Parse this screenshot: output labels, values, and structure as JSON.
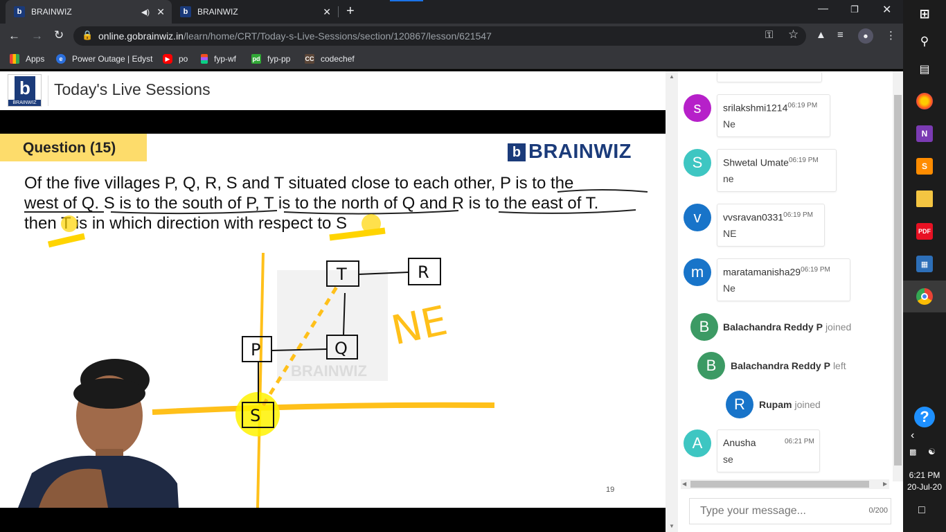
{
  "browser": {
    "tabs": [
      {
        "title": "BRAINWIZ",
        "active": true
      },
      {
        "title": "BRAINWIZ",
        "active": false
      }
    ],
    "url_host": "online.gobrainwiz.in",
    "url_path": "/learn/home/CRT/Today-s-Live-Sessions/section/120867/lesson/621547",
    "bookmarks": [
      "Apps",
      "Power Outage | Edyst",
      "po",
      "fyp-wf",
      "fyp-pp",
      "codechef"
    ]
  },
  "page": {
    "title": "Today's Live Sessions",
    "logo_text": "BRAINWIZ"
  },
  "slide": {
    "question_label": "Question (15)",
    "brand": "BRAINWIZ",
    "line1": "Of the five villages P, Q, R, S and T situated close to each other, P is to the",
    "line2": "west of Q. S is to the south of P, T is to the north of Q and R is to the east of T.",
    "line3": "then T is in which direction with respect to S",
    "diagram_labels": {
      "t": "T",
      "r": "R",
      "p": "P",
      "q": "Q",
      "s": "S",
      "answer": "NE"
    },
    "watermark": "BRAINWIZ",
    "slide_number": "19"
  },
  "chat": {
    "messages": [
      {
        "user": "srilakshmi1214",
        "time": "06:19 PM",
        "text": "Ne",
        "initial": "s",
        "color": "#b620c9"
      },
      {
        "user": "Shwetal Umate",
        "time": "06:19 PM",
        "text": "ne",
        "initial": "S",
        "color": "#3ec6c2"
      },
      {
        "user": "vvsravan0331",
        "time": "06:19 PM",
        "text": "NE",
        "initial": "v",
        "color": "#1874c9"
      },
      {
        "user": "maratamanisha29",
        "time": "06:19 PM",
        "text": "Ne",
        "initial": "m",
        "color": "#1874c9"
      }
    ],
    "events": [
      {
        "initial": "B",
        "user": "Balachandra Reddy P",
        "action": "joined",
        "color": "#3c9a64"
      },
      {
        "initial": "B",
        "user": "Balachandra Reddy P",
        "action": "left",
        "color": "#3c9a64"
      },
      {
        "initial": "R",
        "user": "Rupam",
        "action": "joined",
        "color": "#1874c9"
      }
    ],
    "last_message": {
      "user": "Anusha",
      "time": "06:21 PM",
      "text": "se",
      "initial": "A",
      "color": "#3ec6c2"
    },
    "input_placeholder": "Type your message...",
    "char_count": "0/200"
  },
  "taskbar": {
    "time": "6:21 PM",
    "date": "20-Jul-20"
  },
  "icons": [
    "back-icon",
    "forward-icon",
    "reload-icon",
    "lock-icon",
    "key-icon",
    "star-icon",
    "extensions-icon",
    "media-icon",
    "menu-icon",
    "windows-start-icon",
    "search-icon",
    "task-view-icon",
    "firefox-icon",
    "onenote-icon",
    "sublime-icon",
    "folder-icon",
    "pdf-icon",
    "calculator-icon",
    "chrome-icon",
    "help-icon",
    "notification-icon"
  ]
}
